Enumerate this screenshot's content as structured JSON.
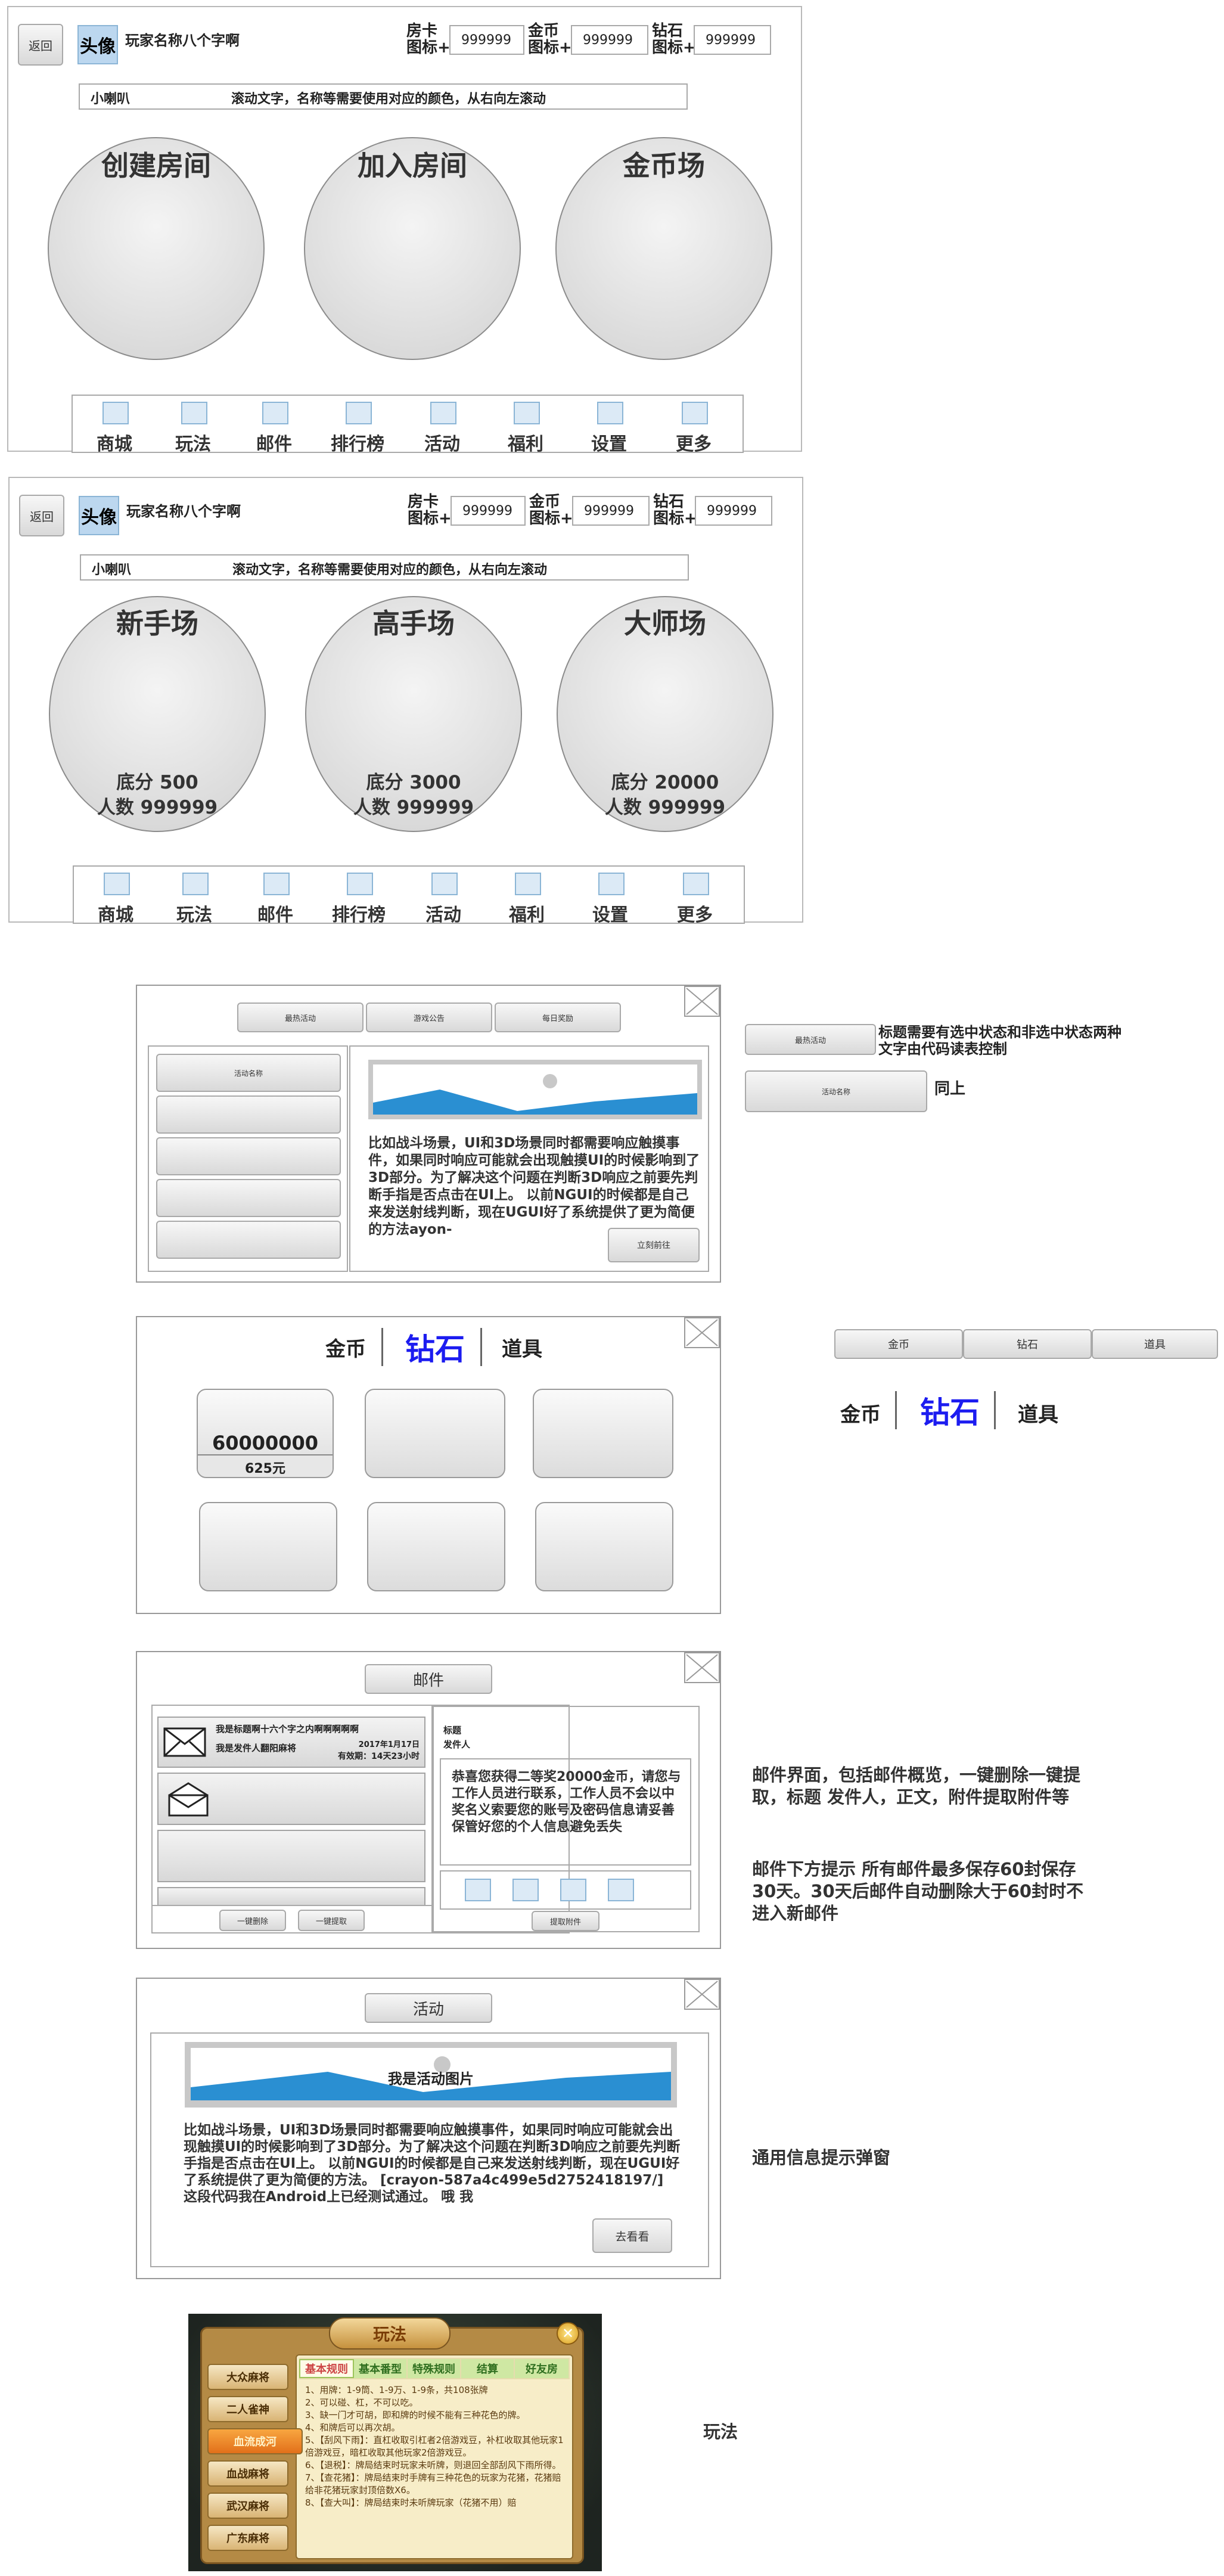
{
  "header": {
    "back_label": "返回",
    "avatar_label": "头像",
    "player_name": "玩家名称八个字啊",
    "currencies": [
      {
        "label_line1": "房卡",
        "label_line2": "图标+",
        "value": "999999"
      },
      {
        "label_line1": "金币",
        "label_line2": "图标+",
        "value": "999999"
      },
      {
        "label_line1": "钻石",
        "label_line2": "图标+",
        "value": "999999"
      }
    ],
    "speaker_label": "小喇叭",
    "marquee_text": "滚动文字，名称等需要使用对应的颜色，从右向左滚动"
  },
  "main_menu": {
    "rooms": [
      "创建房间",
      "加入房间",
      "金币场"
    ]
  },
  "coin_field": {
    "rooms": [
      {
        "title": "新手场",
        "base": "底分 500",
        "count": "人数 999999"
      },
      {
        "title": "高手场",
        "base": "底分 3000",
        "count": "人数 999999"
      },
      {
        "title": "大师场",
        "base": "底分 20000",
        "count": "人数 999999"
      }
    ]
  },
  "nav": {
    "items": [
      "商城",
      "玩法",
      "邮件",
      "排行榜",
      "活动",
      "福利",
      "设置",
      "更多"
    ]
  },
  "activity_panel": {
    "tabs": [
      "最热活动",
      "游戏公告",
      "每日奖励"
    ],
    "list_first": "活动名称",
    "body": "比如战斗场景，UI和3D场景同时都需要响应触摸事件，如果同时响应可能就会出现触摸UI的时候影响到了3D部分。为了解决这个问题在判断3D响应之前要先判断手指是否点击在UI上。 以前NGUI的时候都是自己来发送射线判断，现在UGUI好了系统提供了更为简便的方法ayon-",
    "go_label": "立刻前往",
    "note_tab_label": "最热活动",
    "note_tab_text": "标题需要有选中状态和非选中状态两种文字由代码读表控制",
    "note_item_label": "活动名称",
    "note_item_text": "同上"
  },
  "shop": {
    "tabs": [
      "金币",
      "钻石",
      "道具"
    ],
    "first_amount": "60000000",
    "first_price": "625元",
    "side_buttons": [
      "金币",
      "钻石",
      "道具"
    ],
    "side_tabs": [
      "金币",
      "钻石",
      "道具"
    ]
  },
  "mail": {
    "title": "邮件",
    "first_title": "我是标题啊十六个字之内啊啊啊啊啊",
    "first_sender": "我是发件人翻阳麻将",
    "first_date": "2017年1月17日",
    "first_expire": "有效期：14天23小时",
    "delete_all": "一键删除",
    "take_all": "一键提取",
    "detail_title": "标题",
    "detail_sender": "发件人",
    "detail_body": "恭喜您获得二等奖20000金币，请您与工作人员进行联系，工作人员不会以中奖名义索要您的账号及密码信息请妥善保管好您的个人信息避免丢失",
    "take_attach": "提取附件",
    "note1": "邮件界面，包括邮件概览，一键删除一键提取，标题 发件人，正文，附件提取附件等",
    "note2": "邮件下方提示 所有邮件最多保存60封保存30天。30天后邮件自动删除大于60封时不进入新邮件"
  },
  "notice": {
    "title": "活动",
    "image_label": "我是活动图片",
    "body": "比如战斗场景，UI和3D场景同时都需要响应触摸事件，如果同时响应可能就会出现触摸UI的时候影响到了3D部分。为了解决这个问题在判断3D响应之前要先判断手指是否点击在UI上。 以前NGUI的时候都是自己来发送射线判断，现在UGUI好了系统提供了更为简便的方法。 [crayon-587a4c499e5d2752418197/]   这段代码我在Android上已经测试通过。 哦 我",
    "go_label": "去看看",
    "note": "通用信息提示弹窗"
  },
  "rules": {
    "title": "玩法",
    "tabs": [
      "基本规则",
      "基本番型",
      "特殊规则",
      "结算",
      "好友房"
    ],
    "sides": [
      "大众麻将",
      "二人雀神",
      "血流成河",
      "血战麻将",
      "武汉麻将",
      "广东麻将"
    ],
    "lines": [
      "1、用牌：1-9筒、1-9万、1-9条，共108张牌",
      "2、可以碰、杠，不可以吃。",
      "3、缺一门才可胡，即和牌的时候不能有三种花色的牌。",
      "4、和牌后可以再次胡。",
      "5、【刮风下雨】：直杠收取引杠者2倍游戏豆，补杠收取其他玩家1倍游戏豆，暗杠收取其他玩家2倍游戏豆。",
      "6、【退税】：牌局结束时玩家未听牌，则退回全部刮风下雨所得。",
      "7、【查花猪】：牌局结束时手牌有三种花色的玩家为花猪，花猪赔给非花猪玩家封顶倍数X6。",
      "8、【查大叫】：牌局结束时未听牌玩家（花猪不用）赔"
    ],
    "note": "玩法"
  },
  "colors": {
    "accent_blue": "#1c1cf0",
    "mountain_blue": "#2a8fd2",
    "frame_gray": "#b9b9b9"
  }
}
